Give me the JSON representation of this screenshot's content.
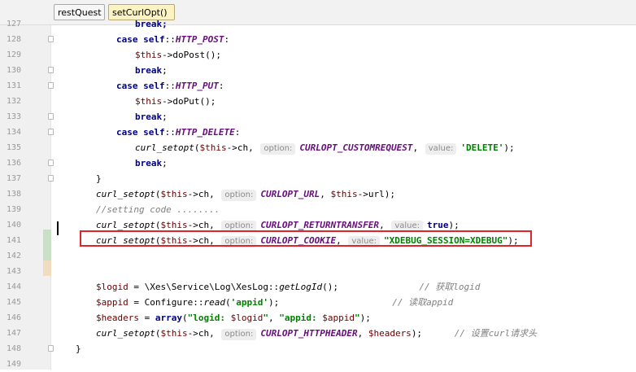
{
  "breadcrumbs": [
    "restQuest",
    "setCurlOpt()"
  ],
  "lines": [
    {
      "num": "127",
      "indent": 166,
      "fold": false,
      "parts": [
        {
          "t": "break;",
          "c": "kw"
        }
      ]
    },
    {
      "num": "128",
      "indent": 143,
      "fold": true,
      "parts": [
        {
          "t": "case ",
          "c": "kw"
        },
        {
          "t": "self",
          "c": "kw"
        },
        {
          "t": "::"
        },
        {
          "t": "HTTP_POST",
          "c": "cst"
        },
        {
          "t": ":"
        }
      ]
    },
    {
      "num": "129",
      "indent": 166,
      "fold": false,
      "parts": [
        {
          "t": "$this",
          "c": "var"
        },
        {
          "t": "->doPost();"
        }
      ]
    },
    {
      "num": "130",
      "indent": 166,
      "fold": true,
      "parts": [
        {
          "t": "break",
          "c": "kw"
        },
        {
          "t": ";"
        }
      ]
    },
    {
      "num": "131",
      "indent": 143,
      "fold": true,
      "parts": [
        {
          "t": "case ",
          "c": "kw"
        },
        {
          "t": "self",
          "c": "kw"
        },
        {
          "t": "::"
        },
        {
          "t": "HTTP_PUT",
          "c": "cst"
        },
        {
          "t": ":"
        }
      ]
    },
    {
      "num": "132",
      "indent": 166,
      "fold": false,
      "parts": [
        {
          "t": "$this",
          "c": "var"
        },
        {
          "t": "->doPut();"
        }
      ]
    },
    {
      "num": "133",
      "indent": 166,
      "fold": true,
      "parts": [
        {
          "t": "break",
          "c": "kw"
        },
        {
          "t": ";"
        }
      ]
    },
    {
      "num": "134",
      "indent": 143,
      "fold": true,
      "parts": [
        {
          "t": "case ",
          "c": "kw"
        },
        {
          "t": "self",
          "c": "kw"
        },
        {
          "t": "::"
        },
        {
          "t": "HTTP_DELETE",
          "c": "cst"
        },
        {
          "t": ":"
        }
      ]
    },
    {
      "num": "135",
      "indent": 166,
      "fold": false,
      "parts": [
        {
          "t": "curl_setopt",
          "c": "fn"
        },
        {
          "t": "("
        },
        {
          "t": "$this",
          "c": "var"
        },
        {
          "t": "->ch, "
        },
        {
          "t": "option:",
          "c": "hint"
        },
        {
          "t": "CURLOPT_CUSTOMREQUEST",
          "c": "cst"
        },
        {
          "t": ", "
        },
        {
          "t": "value:",
          "c": "hint"
        },
        {
          "t": "'DELETE'",
          "c": "str"
        },
        {
          "t": ");"
        }
      ]
    },
    {
      "num": "136",
      "indent": 166,
      "fold": true,
      "parts": [
        {
          "t": "break",
          "c": "kw"
        },
        {
          "t": ";"
        }
      ]
    },
    {
      "num": "137",
      "indent": 118,
      "fold": true,
      "parts": [
        {
          "t": "}"
        }
      ]
    },
    {
      "num": "138",
      "indent": 118,
      "fold": false,
      "parts": [
        {
          "t": "curl_setopt",
          "c": "fn"
        },
        {
          "t": "("
        },
        {
          "t": "$this",
          "c": "var"
        },
        {
          "t": "->ch, "
        },
        {
          "t": "option:",
          "c": "hint"
        },
        {
          "t": "CURLOPT_URL",
          "c": "cst"
        },
        {
          "t": ", "
        },
        {
          "t": "$this",
          "c": "var"
        },
        {
          "t": "->url);"
        }
      ]
    },
    {
      "num": "139",
      "indent": 118,
      "fold": false,
      "parts": [
        {
          "t": "//setting code ........",
          "c": "cm"
        }
      ]
    },
    {
      "num": "140",
      "indent": 118,
      "fold": false,
      "parts": [
        {
          "t": "curl_setopt",
          "c": "fn"
        },
        {
          "t": "("
        },
        {
          "t": "$this",
          "c": "var"
        },
        {
          "t": "->ch, "
        },
        {
          "t": "option:",
          "c": "hint"
        },
        {
          "t": "CURLOPT_RETURNTRANSFER",
          "c": "cst"
        },
        {
          "t": ", "
        },
        {
          "t": "value:",
          "c": "hint"
        },
        {
          "t": "true",
          "c": "kw"
        },
        {
          "t": ");"
        }
      ]
    },
    {
      "num": "141",
      "indent": 118,
      "fold": false,
      "parts": [
        {
          "t": "curl_setopt",
          "c": "fn"
        },
        {
          "t": "("
        },
        {
          "t": "$this",
          "c": "var"
        },
        {
          "t": "->ch, "
        },
        {
          "t": "option:",
          "c": "hint"
        },
        {
          "t": "CURLOPT_COOKIE",
          "c": "cst"
        },
        {
          "t": ", "
        },
        {
          "t": "value:",
          "c": "hint"
        },
        {
          "t": "\"XDEBUG_SESSION=XDEBUG\"",
          "c": "str"
        },
        {
          "t": ");"
        }
      ]
    },
    {
      "num": "142",
      "indent": 118,
      "fold": false,
      "parts": []
    },
    {
      "num": "143",
      "indent": 118,
      "fold": false,
      "parts": []
    },
    {
      "num": "144",
      "indent": 118,
      "fold": false,
      "parts": [
        {
          "t": "$logid",
          "c": "var"
        },
        {
          "t": " = \\Xes\\Service\\Log\\XesLog::"
        },
        {
          "t": "getLogId",
          "c": "fn"
        },
        {
          "t": "();               "
        },
        {
          "t": "// 获取logid",
          "c": "cm"
        }
      ]
    },
    {
      "num": "145",
      "indent": 118,
      "fold": false,
      "parts": [
        {
          "t": "$appid",
          "c": "var"
        },
        {
          "t": " = Configure::"
        },
        {
          "t": "read",
          "c": "fn"
        },
        {
          "t": "("
        },
        {
          "t": "'appid'",
          "c": "str"
        },
        {
          "t": ");                     "
        },
        {
          "t": "// 读取appid",
          "c": "cm"
        }
      ]
    },
    {
      "num": "146",
      "indent": 118,
      "fold": false,
      "parts": [
        {
          "t": "$headers",
          "c": "var"
        },
        {
          "t": " = "
        },
        {
          "t": "array",
          "c": "kw"
        },
        {
          "t": "("
        },
        {
          "t": "\"logid: ",
          "c": "str"
        },
        {
          "t": "$logid",
          "c": "var"
        },
        {
          "t": "\"",
          "c": "str"
        },
        {
          "t": ", "
        },
        {
          "t": "\"appid: ",
          "c": "str"
        },
        {
          "t": "$appid",
          "c": "var"
        },
        {
          "t": "\"",
          "c": "str"
        },
        {
          "t": ");"
        }
      ]
    },
    {
      "num": "147",
      "indent": 118,
      "fold": false,
      "parts": [
        {
          "t": "curl_setopt",
          "c": "fn"
        },
        {
          "t": "("
        },
        {
          "t": "$this",
          "c": "var"
        },
        {
          "t": "->ch, "
        },
        {
          "t": "option:",
          "c": "hint"
        },
        {
          "t": "CURLOPT_HTTPHEADER",
          "c": "cst"
        },
        {
          "t": ", "
        },
        {
          "t": "$headers",
          "c": "var"
        },
        {
          "t": ");      "
        },
        {
          "t": "// 设置curl请求头",
          "c": "cm"
        }
      ]
    },
    {
      "num": "148",
      "indent": 93,
      "fold": true,
      "parts": [
        {
          "t": "}"
        }
      ]
    },
    {
      "num": "149",
      "indent": 93,
      "fold": false,
      "parts": []
    }
  ],
  "colors": {
    "highlight_box": "#e0242a",
    "vcs_added": "#c9dfc6",
    "vcs_modified": "#f2dcc0"
  }
}
